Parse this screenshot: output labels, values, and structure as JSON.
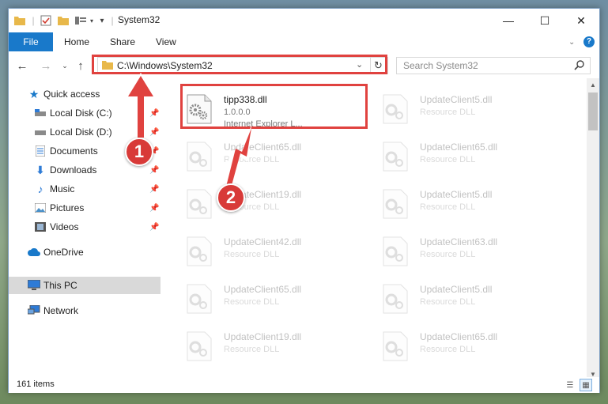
{
  "window": {
    "title": "System32",
    "controls": {
      "minimize": "—",
      "maximize": "☐",
      "close": "✕"
    }
  },
  "ribbon": {
    "tabs": [
      {
        "label": "File",
        "active": true
      },
      {
        "label": "Home"
      },
      {
        "label": "Share"
      },
      {
        "label": "View"
      }
    ]
  },
  "address": {
    "path": "C:\\Windows\\System32",
    "search_placeholder": "Search System32"
  },
  "sidebar": {
    "items": [
      {
        "label": "Quick access",
        "icon": "star-icon"
      },
      {
        "label": "Local Disk (C:)",
        "icon": "drive-icon",
        "pinned": true
      },
      {
        "label": "Local Disk (D:)",
        "icon": "drive-icon",
        "pinned": true
      },
      {
        "label": "Documents",
        "icon": "documents-icon",
        "pinned": true
      },
      {
        "label": "Downloads",
        "icon": "downloads-icon",
        "pinned": true
      },
      {
        "label": "Music",
        "icon": "music-icon",
        "pinned": true
      },
      {
        "label": "Pictures",
        "icon": "pictures-icon",
        "pinned": true
      },
      {
        "label": "Videos",
        "icon": "videos-icon",
        "pinned": true
      },
      {
        "label": "OneDrive",
        "icon": "cloud-icon"
      },
      {
        "label": "This PC",
        "icon": "computer-icon",
        "selected": true
      },
      {
        "label": "Network",
        "icon": "network-icon"
      }
    ]
  },
  "files": {
    "highlighted": {
      "name": "tipp338.dll",
      "version": "1.0.0.0",
      "description": "Internet Explorer L..."
    },
    "left_column": [
      {
        "name": "UpdateClient65.dll",
        "desc": "Resource DLL"
      },
      {
        "name": "UpdateClient19.dll",
        "desc": "Resource DLL"
      },
      {
        "name": "UpdateClient42.dll",
        "desc": "Resource DLL"
      },
      {
        "name": "UpdateClient65.dll",
        "desc": "Resource DLL"
      },
      {
        "name": "UpdateClient19.dll",
        "desc": "Resource DLL"
      }
    ],
    "right_column": [
      {
        "name": "UpdateClient5.dll",
        "desc": "Resource DLL"
      },
      {
        "name": "UpdateClient65.dll",
        "desc": "Resource DLL"
      },
      {
        "name": "UpdateClient5.dll",
        "desc": "Resource DLL"
      },
      {
        "name": "UpdateClient63.dll",
        "desc": "Resource DLL"
      },
      {
        "name": "UpdateClient5.dll",
        "desc": "Resource DLL"
      },
      {
        "name": "UpdateClient65.dll",
        "desc": "Resource DLL"
      }
    ]
  },
  "status": {
    "item_count": "161 items"
  },
  "annotations": {
    "step1": "1",
    "step2": "2",
    "color": "#e0423f"
  }
}
